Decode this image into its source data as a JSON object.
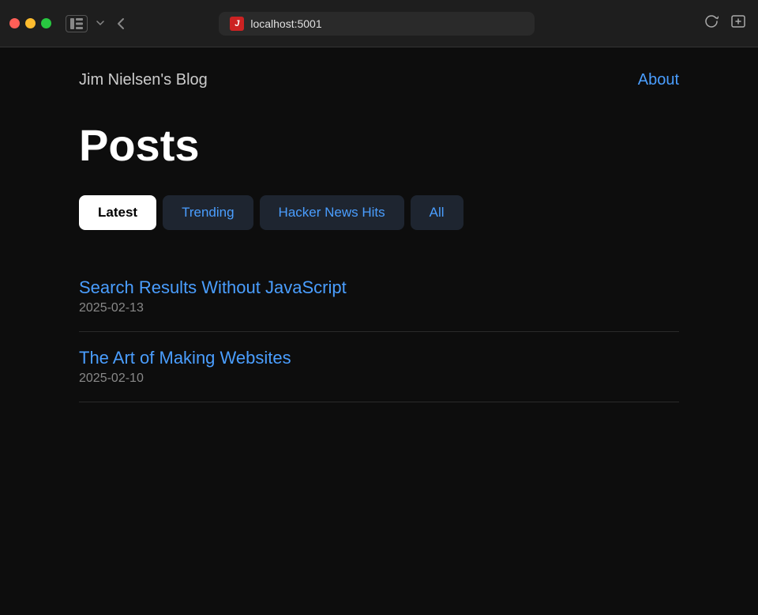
{
  "browser": {
    "url": "localhost:5001",
    "favicon_text": "𝕁",
    "reload_icon": "↻",
    "share_icon": "⊡"
  },
  "nav": {
    "site_title": "Jim Nielsen's Blog",
    "about_label": "About"
  },
  "main": {
    "page_title": "Posts",
    "tabs": [
      {
        "id": "latest",
        "label": "Latest",
        "active": true
      },
      {
        "id": "trending",
        "label": "Trending",
        "active": false
      },
      {
        "id": "hacker-news-hits",
        "label": "Hacker News Hits",
        "active": false
      },
      {
        "id": "all",
        "label": "All",
        "active": false
      }
    ],
    "posts": [
      {
        "title": "Search Results Without JavaScript",
        "date": "2025-02-13",
        "url": "#"
      },
      {
        "title": "The Art of Making Websites",
        "date": "2025-02-10",
        "url": "#"
      }
    ]
  }
}
